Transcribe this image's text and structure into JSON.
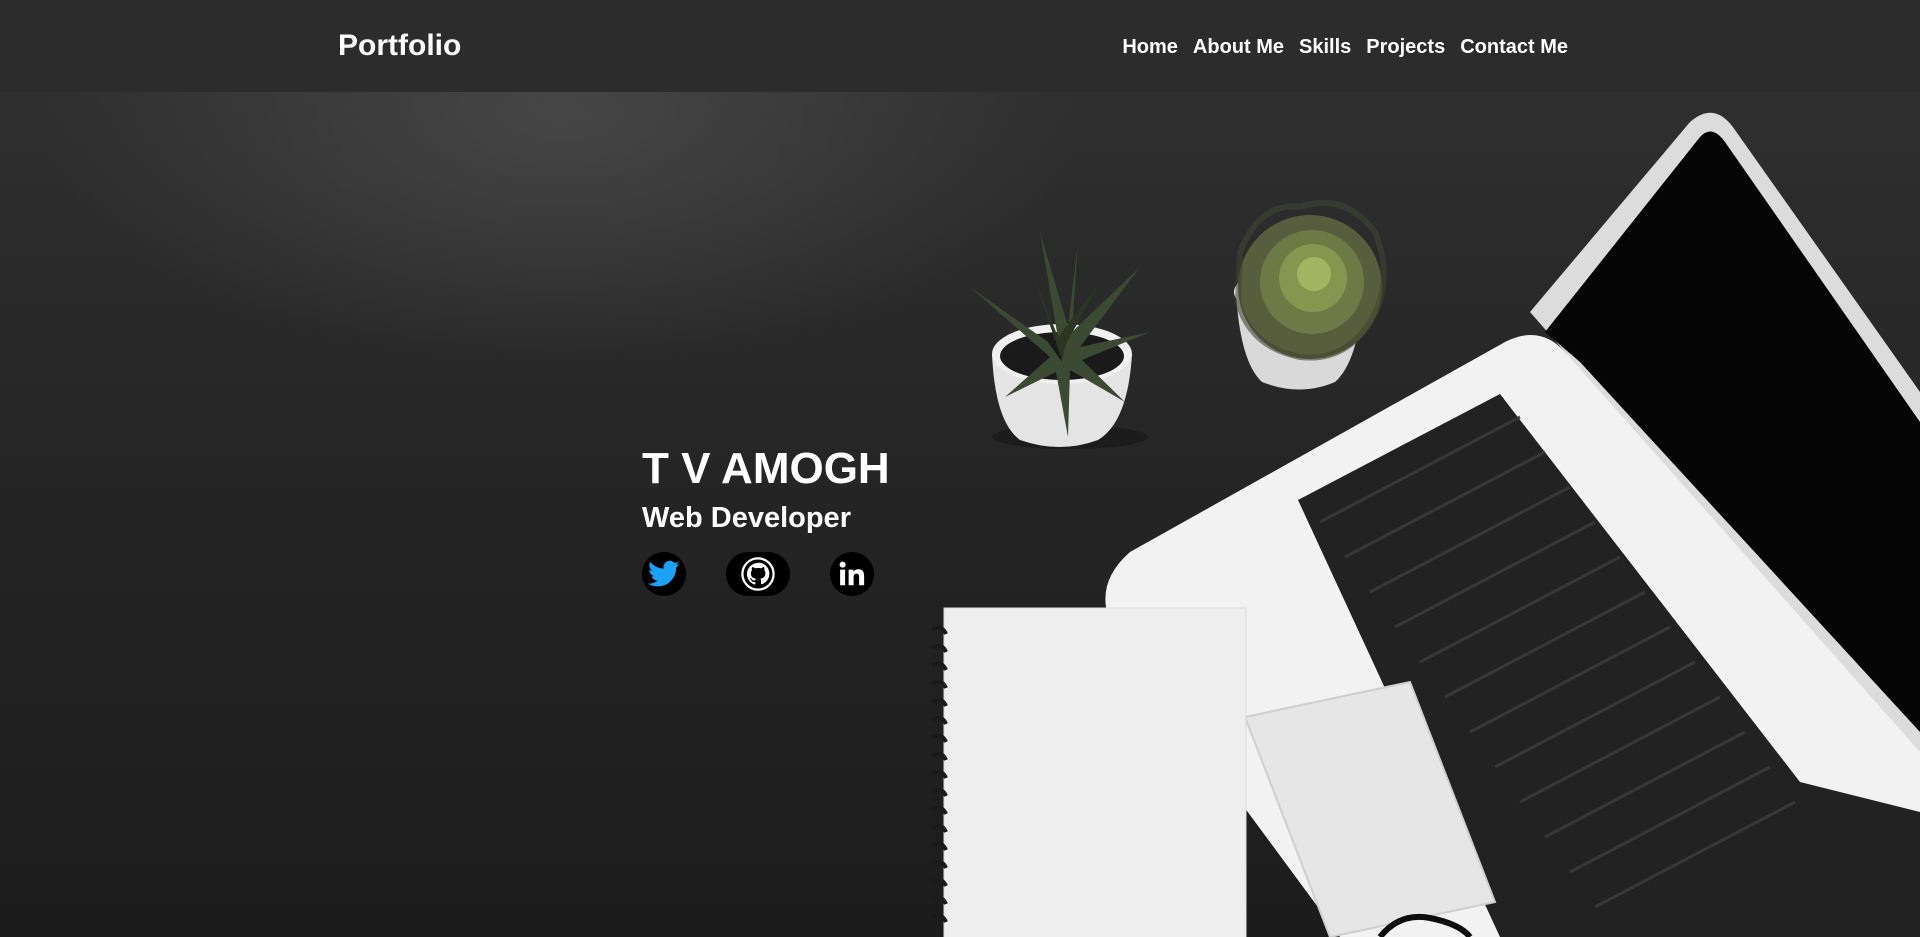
{
  "header": {
    "brand": "Portfolio",
    "nav": [
      "Home",
      "About Me",
      "Skills",
      "Projects",
      "Contact Me"
    ]
  },
  "hero": {
    "name": "T V AMOGH",
    "role": "Web Developer",
    "socials": [
      {
        "icon": "twitter-icon",
        "color": "#1da1f2"
      },
      {
        "icon": "github-icon",
        "color": "#ffffff"
      },
      {
        "icon": "linkedin-icon",
        "color": "#ffffff"
      }
    ]
  },
  "colors": {
    "navbar": "#2c2c2c",
    "background": "#1e1e1e",
    "text": "#ffffff",
    "twitter": "#1da1f2"
  }
}
